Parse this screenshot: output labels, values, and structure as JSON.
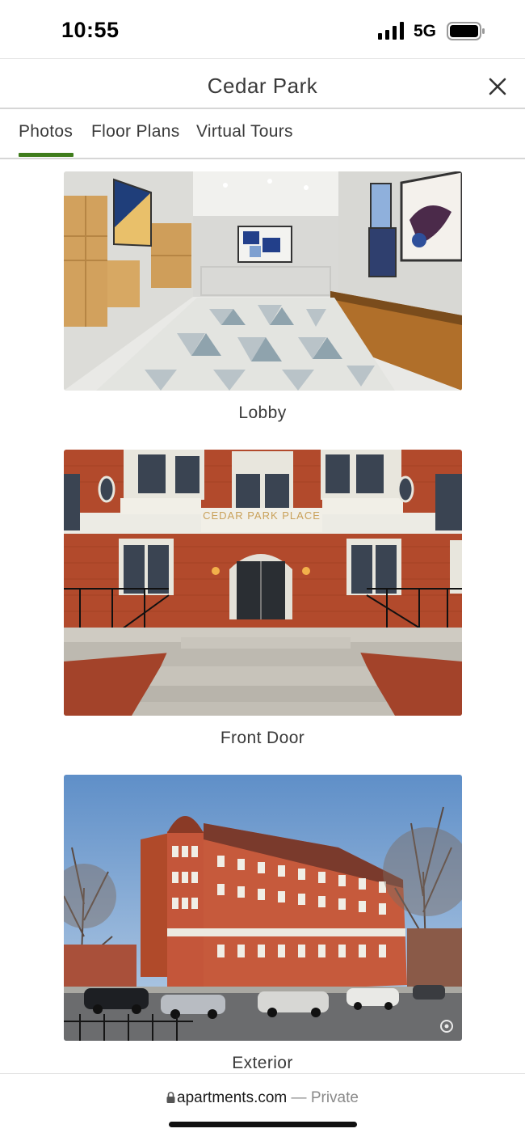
{
  "status_bar": {
    "time": "10:55",
    "network": "5G",
    "signal_icon": "signal-bars-icon",
    "battery_icon": "battery-icon"
  },
  "header": {
    "title": "Cedar Park",
    "close_icon": "close-icon"
  },
  "tabs": [
    {
      "label": "Photos",
      "active": true
    },
    {
      "label": "Floor Plans",
      "active": false
    },
    {
      "label": "Virtual Tours",
      "active": false
    }
  ],
  "gallery": {
    "photos": [
      {
        "caption": "Lobby"
      },
      {
        "caption": "Front Door",
        "sign_text": "CEDAR PARK PLACE"
      },
      {
        "caption": "Exterior"
      }
    ]
  },
  "browser_bar": {
    "domain": "apartments.com",
    "private_label": " — Private",
    "lock_icon": "lock-icon"
  },
  "colors": {
    "accent": "#3f7d1c",
    "text": "#3a3a3a",
    "divider": "#d6d6d6"
  }
}
